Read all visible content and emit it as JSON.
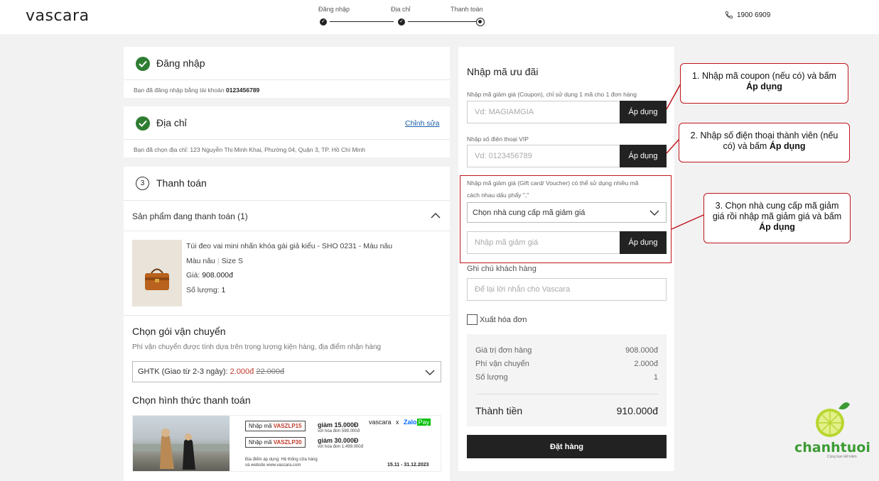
{
  "header": {
    "logo": "vascara",
    "steps": [
      "Đăng nhập",
      "Địa chỉ",
      "Thanh toán"
    ],
    "hotline": "1900 6909"
  },
  "login_card": {
    "title": "Đăng nhập",
    "sub_prefix": "Bạn đã đăng nhập bằng tài khoản",
    "account": "0123456789"
  },
  "address_card": {
    "title": "Địa chỉ",
    "edit_label": "Chỉnh sửa",
    "sub": "Bạn đã chọn địa chỉ: 123 Nguyễn Thị Minh Khai, Phường 04, Quận 3, TP. Hồ Chí Minh"
  },
  "payment_card": {
    "step_number": "3",
    "title": "Thanh toán",
    "products_header": "Sản phẩm đang thanh toán (1)",
    "product": {
      "name": "Túi đeo vai mini nhấn khóa gài giả kiểu - SHO 0231 - Màu nâu",
      "color": "Màu nâu",
      "size": "Size S",
      "price_label": "Giá:",
      "price": "908.000đ",
      "qty_label": "Số lượng:",
      "qty": "1"
    },
    "shipping_heading": "Chọn gói vận chuyển",
    "shipping_hint": "Phí vận chuyển được tính dựa trên trọng lượng kiện hàng, địa điểm nhận hàng",
    "shipping_option": "GHTK (Giao từ 2-3 ngày):",
    "shipping_price": "2.000đ",
    "shipping_old_price": "22.000đ",
    "payment_heading": "Chọn hình thức thanh toán",
    "banner": {
      "code_label": "Nhập mã",
      "code1": "VASZLP15",
      "gift1": "giảm 15.000Đ",
      "min1": "với hóa đơn 599.000đ",
      "code2": "VASZLP30",
      "gift2": "giảm 30.000Đ",
      "min2": "với hóa đơn 1.499.000đ",
      "brand": "vascara",
      "x": "x",
      "zalo": "Zalo",
      "pay": "Pay",
      "place_line1": "Địa điểm áp dụng: Hệ thống cửa hàng",
      "place_line2": "và website www.vascara.com",
      "dates": "15.11 - 31.12.2023"
    }
  },
  "promo": {
    "title": "Nhập mã ưu đãi",
    "coupon_label": "Nhập mã giảm giá (Coupon), chỉ sử dụng 1 mã cho 1 đơn hàng",
    "coupon_placeholder": "Vd: MAGIAMGIA",
    "apply": "Áp dụng",
    "vip_label": "Nhập số điện thoại VIP",
    "vip_placeholder": "Vd: 0123456789",
    "gift_label_line1": "Nhập mã giảm giá (Gift card/ Voucher) có thể sử dụng nhiều mã",
    "gift_label_line2": "cách nhau dấu phẩy \",\"",
    "provider_select": "Chọn nhà cung cấp mã giảm giá",
    "gift_placeholder": "Nhập mã giảm giá",
    "note_label": "Ghi chú khách hàng",
    "note_placeholder": "Để lại lời nhắn cho Vascara",
    "invoice_label": "Xuất hóa đơn"
  },
  "summary": {
    "rows": [
      {
        "label": "Giá trị đơn hàng",
        "value": "908.000đ"
      },
      {
        "label": "Phí vận chuyển",
        "value": "2.000đ"
      },
      {
        "label": "Số lượng",
        "value": "1"
      }
    ],
    "total_label": "Thành tiền",
    "total_value": "910.000đ",
    "order_button": "Đặt hàng"
  },
  "annotations": {
    "note1_line1": "1. Nhập mã coupon (nếu có) và bấm",
    "note1_bold": "Áp dụng",
    "note2_line1": "2. Nhập số điện thoại thành viên (nếu",
    "note2_line2": "có) và bấm",
    "note2_bold": "Áp dụng",
    "note3_line1": "3. Chọn nhà cung cấp mã giảm",
    "note3_line2": "giá rồi nhập mã giảm giá và bấm",
    "note3_bold": "Áp dụng"
  },
  "watermark": {
    "text": "chanhtuoi",
    "tagline": "Cùng bạn tiết kiệm"
  },
  "colors": {
    "accent_dark": "#222222",
    "success_green": "#2e7d32",
    "annotation_red": "#c0151c",
    "price_red": "#c0392b",
    "link_blue": "#1a5fa8"
  }
}
